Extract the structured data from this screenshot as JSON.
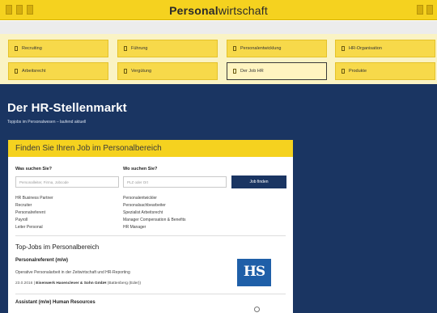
{
  "brand": {
    "bold": "Personal",
    "light": "wirtschaft"
  },
  "nav": {
    "row1": [
      {
        "label": "Recruiting"
      },
      {
        "label": "Führung"
      },
      {
        "label": "Personalentwicklung"
      },
      {
        "label": "HR-Organisation"
      }
    ],
    "row2": [
      {
        "label": "Arbeitsrecht"
      },
      {
        "label": "Vergütung"
      },
      {
        "label": "Der Job HR",
        "active": true
      },
      {
        "label": "Produkte"
      }
    ]
  },
  "page": {
    "title": "Der HR-Stellenmarkt",
    "subtitle": "Topjobs im Personalwesen – laufend aktuell"
  },
  "search": {
    "heading": "Finden Sie Ihren Job im Personalbereich",
    "what_label": "Was suchen Sie?",
    "what_placeholder": "Personalleiter, Firma, Jobcode",
    "where_label": "Wo suchen Sie?",
    "where_placeholder": "PLZ oder Ort",
    "button": "Job finden",
    "links_left": [
      "HR Business Partner",
      "Recruiter",
      "Personalreferent",
      "Payroll",
      "Leiter Personal"
    ],
    "links_right": [
      "Personalentwickler",
      "Personalsachbearbeiter",
      "Spezialist Arbeitsrecht",
      "Manager Compensation & Benefits",
      "HR Manager"
    ]
  },
  "topjobs": {
    "heading": "Top-Jobs im Personalbereich",
    "job1": {
      "title": "Personalreferent (m/w)",
      "desc": "Operative Personalarbeit in der Zeitwirtschaft und HR-Reporting",
      "date": "23.0.2016",
      "company": "Eisenwerk Hasenclever & Sohn GmbH",
      "location": "(Battenberg (Eder))",
      "logo_text": "HS"
    },
    "job2": {
      "title": "Assistant (m/w) Human Resources"
    }
  }
}
